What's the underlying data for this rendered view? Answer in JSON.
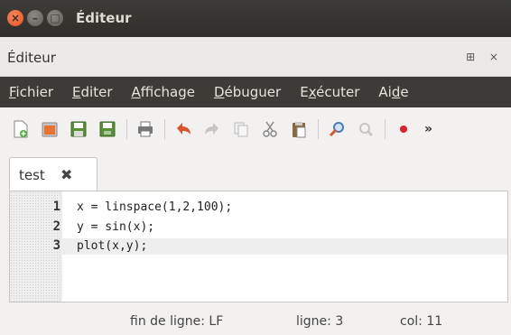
{
  "window": {
    "title": "Éditeur"
  },
  "dock": {
    "title": "Éditeur",
    "controls": "⊞ ×"
  },
  "menu": {
    "items": [
      {
        "accel": "F",
        "rest": "ichier"
      },
      {
        "accel": "E",
        "rest": "diter"
      },
      {
        "accel": "A",
        "rest": "ffichage"
      },
      {
        "accel": "D",
        "rest": "ébuguer"
      },
      {
        "pre": "E",
        "accel": "x",
        "rest": "écuter"
      },
      {
        "pre": "Ai",
        "accel": "d",
        "rest": "e"
      }
    ]
  },
  "toolbar": {
    "icons": [
      "new-file-icon",
      "open-file-icon",
      "save-icon",
      "save-all-icon",
      "print-icon",
      "undo-icon",
      "redo-icon",
      "copy-icon",
      "cut-icon",
      "paste-icon",
      "find-icon",
      "toggle-comment-icon",
      "breakpoint-icon"
    ],
    "overflow": "»",
    "colors": {
      "undo": "#d9542a",
      "breakpoint": "#e0202a"
    }
  },
  "tab": {
    "label": "test",
    "close": "✖"
  },
  "editor": {
    "lines": [
      {
        "number": "1",
        "code": "x = linspace(1,2,100);"
      },
      {
        "number": "2",
        "code": "y = sin(x);"
      },
      {
        "number": "3",
        "code": "plot(x,y);"
      }
    ],
    "current_line": 3
  },
  "status": {
    "eol": "fin de ligne: LF",
    "line": "ligne: 3",
    "col": "col: 11"
  }
}
